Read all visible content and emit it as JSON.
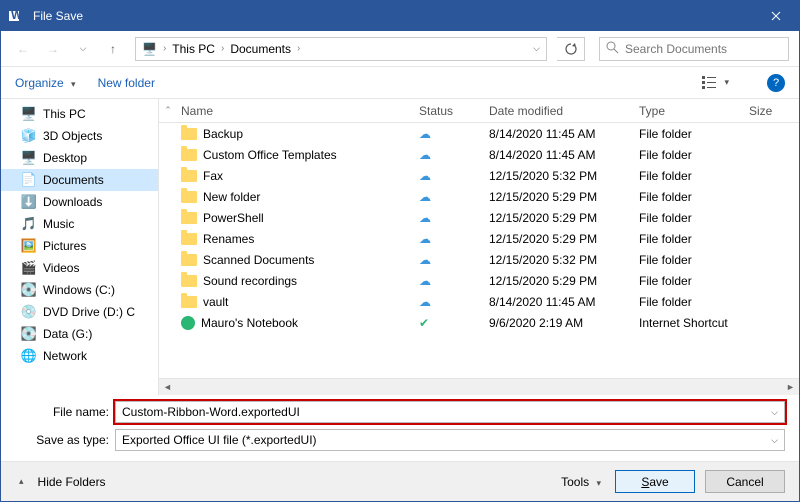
{
  "title": "File Save",
  "nav": {
    "crumbs": [
      "This PC",
      "Documents"
    ],
    "search_placeholder": "Search Documents"
  },
  "toolbar": {
    "organize": "Organize",
    "new_folder": "New folder"
  },
  "sidebar": {
    "items": [
      {
        "icon": "pc",
        "label": "This PC"
      },
      {
        "icon": "3d",
        "label": "3D Objects"
      },
      {
        "icon": "desktop",
        "label": "Desktop"
      },
      {
        "icon": "docs",
        "label": "Documents",
        "selected": true
      },
      {
        "icon": "downloads",
        "label": "Downloads"
      },
      {
        "icon": "music",
        "label": "Music"
      },
      {
        "icon": "pictures",
        "label": "Pictures"
      },
      {
        "icon": "videos",
        "label": "Videos"
      },
      {
        "icon": "drive",
        "label": "Windows (C:)"
      },
      {
        "icon": "dvd",
        "label": "DVD Drive (D:) C"
      },
      {
        "icon": "drive",
        "label": "Data (G:)"
      },
      {
        "icon": "network",
        "label": "Network"
      }
    ]
  },
  "columns": {
    "name": "Name",
    "status": "Status",
    "date": "Date modified",
    "type": "Type",
    "size": "Size"
  },
  "files": [
    {
      "kind": "folder",
      "name": "Backup",
      "status": "cloud",
      "date": "8/14/2020 11:45 AM",
      "type": "File folder"
    },
    {
      "kind": "folder",
      "name": "Custom Office Templates",
      "status": "cloud",
      "date": "8/14/2020 11:45 AM",
      "type": "File folder"
    },
    {
      "kind": "folder",
      "name": "Fax",
      "status": "cloud",
      "date": "12/15/2020 5:32 PM",
      "type": "File folder"
    },
    {
      "kind": "folder",
      "name": "New folder",
      "status": "cloud",
      "date": "12/15/2020 5:29 PM",
      "type": "File folder"
    },
    {
      "kind": "folder",
      "name": "PowerShell",
      "status": "cloud",
      "date": "12/15/2020 5:29 PM",
      "type": "File folder"
    },
    {
      "kind": "folder",
      "name": "Renames",
      "status": "cloud",
      "date": "12/15/2020 5:29 PM",
      "type": "File folder"
    },
    {
      "kind": "folder",
      "name": "Scanned Documents",
      "status": "cloud",
      "date": "12/15/2020 5:32 PM",
      "type": "File folder"
    },
    {
      "kind": "folder",
      "name": "Sound recordings",
      "status": "cloud",
      "date": "12/15/2020 5:29 PM",
      "type": "File folder"
    },
    {
      "kind": "folder",
      "name": "vault",
      "status": "cloud",
      "date": "8/14/2020 11:45 AM",
      "type": "File folder"
    },
    {
      "kind": "link",
      "name": "Mauro's Notebook",
      "status": "check",
      "date": "9/6/2020 2:19 AM",
      "type": "Internet Shortcut"
    }
  ],
  "form": {
    "file_name_label": "File name:",
    "file_name_value": "Custom-Ribbon-Word.exportedUI",
    "save_type_label": "Save as type:",
    "save_type_value": "Exported Office UI file (*.exportedUI)"
  },
  "buttons": {
    "hide_folders": "Hide Folders",
    "tools": "Tools",
    "save": "Save",
    "cancel": "Cancel"
  }
}
